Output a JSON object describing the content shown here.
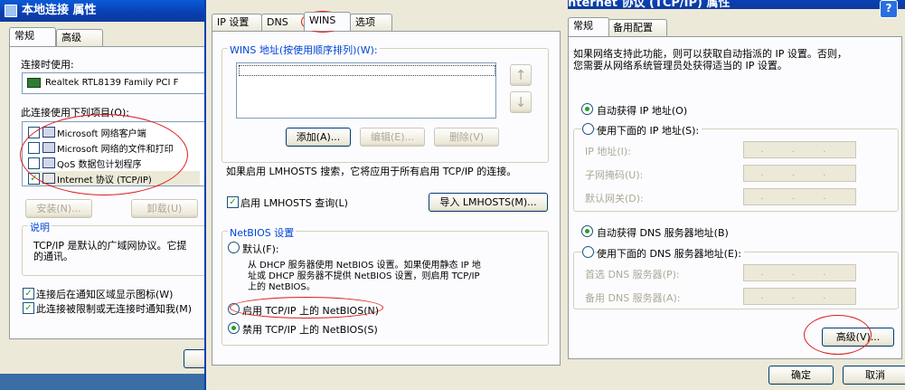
{
  "left_dialog": {
    "title": "本地连接 属性",
    "tabs": [
      "常规",
      "高级"
    ],
    "connect_using_label": "连接时使用:",
    "adapter_name": "Realtek RTL8139 Family PCI F",
    "items_label": "此连接使用下列项目(O):",
    "items": [
      {
        "label": "Microsoft 网络客户端",
        "checked": false
      },
      {
        "label": "Microsoft 网络的文件和打印",
        "checked": false
      },
      {
        "label": "QoS 数据包计划程序",
        "checked": false
      },
      {
        "label": "Internet 协议 (TCP/IP)",
        "checked": true
      }
    ],
    "install_button": "安装(N)...",
    "uninstall_button": "卸载(U)",
    "description_title": "说明",
    "description_text_1": "TCP/IP 是默认的广域网协议。它提",
    "description_text_2": "的通讯。",
    "show_icon_label": "连接后在通知区域显示图标(W)",
    "notify_label": "此连接被限制或无连接时通知我(M)"
  },
  "center_dialog": {
    "tabs": [
      "IP 设置",
      "DNS",
      "WINS",
      "选项"
    ],
    "wins_group_title": "WINS 地址(按使用顺序排列)(W):",
    "add_button": "添加(A)...",
    "edit_button": "编辑(E)...",
    "delete_button": "删除(V)",
    "up_arrow": "↑",
    "down_arrow": "↓",
    "lmhosts_info": "如果启用 LMHOSTS 搜索，它将应用于所有启用 TCP/IP 的连接。",
    "enable_lmhosts_label": "启用 LMHOSTS 查询(L)",
    "import_lmhosts_button": "导入 LMHOSTS(M)...",
    "netbios_group_title": "NetBIOS 设置",
    "default_label": "默认(F):",
    "default_desc_1": "从 DHCP 服务器使用 NetBIOS 设置。如果使用静态 IP 地",
    "default_desc_2": "址或 DHCP 服务器不提供 NetBIOS 设置，则启用 TCP/IP",
    "default_desc_3": "上的 NetBIOS。",
    "enable_netbios_label": "启用 TCP/IP 上的 NetBIOS(N)",
    "disable_netbios_label": "禁用 TCP/IP 上的 NetBIOS(S)"
  },
  "right_dialog": {
    "title": "nternet 协议 (TCP/IP) 属性",
    "help_button": "?",
    "tabs": [
      "常规",
      "备用配置"
    ],
    "intro_1": "如果网络支持此功能，则可以获取自动指派的 IP 设置。否则，",
    "intro_2": "您需要从网络系统管理员处获得适当的 IP 设置。",
    "auto_ip_label": "自动获得 IP 地址(O)",
    "manual_ip_label": "使用下面的 IP 地址(S):",
    "ip_address_label": "IP 地址(I):",
    "subnet_label": "子网掩码(U):",
    "gateway_label": "默认网关(D):",
    "auto_dns_label": "自动获得 DNS 服务器地址(B)",
    "manual_dns_label": "使用下面的 DNS 服务器地址(E):",
    "preferred_dns_label": "首选 DNS 服务器(P):",
    "alternate_dns_label": "备用 DNS 服务器(A):",
    "ip_placeholder": ". . .",
    "advanced_button": "高级(V)...",
    "ok_button": "确定",
    "cancel_button": "取消"
  },
  "colors": {
    "annotation_red": "#e01a1a",
    "dialog_bg": "#ece9d8",
    "titlebar_blue": "#0a3fb0"
  }
}
